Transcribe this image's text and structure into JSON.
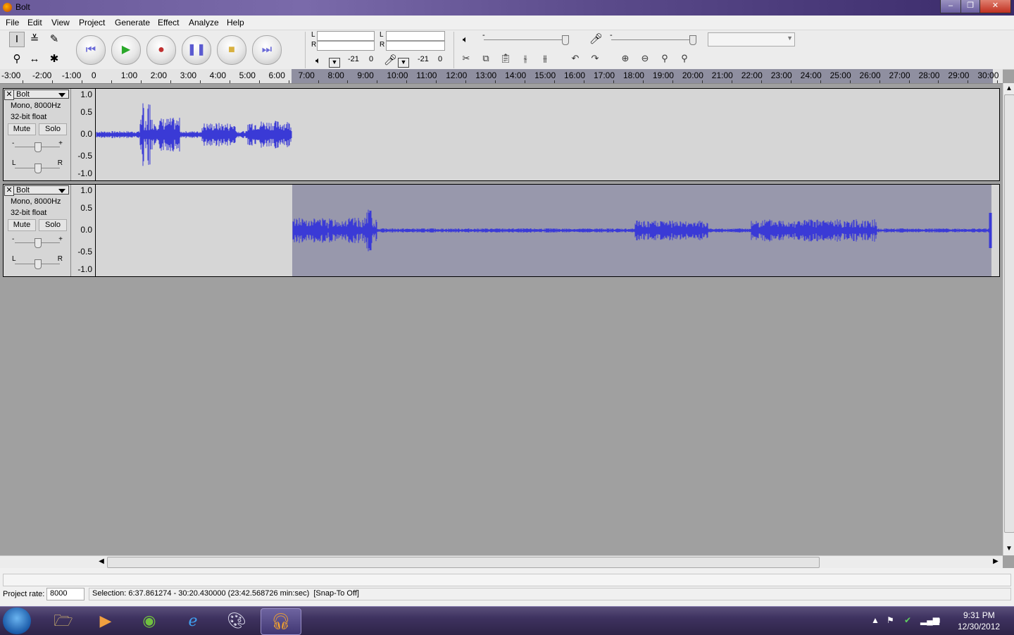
{
  "window": {
    "title": "Bolt"
  },
  "menu": [
    "File",
    "Edit",
    "View",
    "Project",
    "Generate",
    "Effect",
    "Analyze",
    "Help"
  ],
  "meters": {
    "playback": {
      "l": "L",
      "r": "R",
      "db": "-21",
      "zero": "0"
    },
    "record": {
      "l": "L",
      "r": "R",
      "db": "-21",
      "zero": "0"
    },
    "slider_minus": "-"
  },
  "ruler": {
    "labels": [
      "-3:00",
      "-2:00",
      "-1:00",
      "0",
      "1:00",
      "2:00",
      "3:00",
      "4:00",
      "5:00",
      "6:00",
      "7:00",
      "8:00",
      "9:00",
      "10:00",
      "11:00",
      "12:00",
      "13:00",
      "14:00",
      "15:00",
      "16:00",
      "17:00",
      "18:00",
      "19:00",
      "20:00",
      "21:00",
      "22:00",
      "23:00",
      "24:00",
      "25:00",
      "26:00",
      "27:00",
      "28:00",
      "29:00",
      "30:00"
    ]
  },
  "tracks": [
    {
      "name": "Bolt",
      "format": "Mono, 8000Hz",
      "bits": "32-bit float",
      "mute": "Mute",
      "solo": "Solo",
      "gain_minus": "-",
      "gain_plus": "+",
      "pan_l": "L",
      "pan_r": "R",
      "scale": [
        "1.0",
        "0.5",
        "0.0",
        "-0.5",
        "-1.0"
      ]
    },
    {
      "name": "Bolt",
      "format": "Mono, 8000Hz",
      "bits": "32-bit float",
      "mute": "Mute",
      "solo": "Solo",
      "gain_minus": "-",
      "gain_plus": "+",
      "pan_l": "L",
      "pan_r": "R",
      "scale": [
        "1.0",
        "0.5",
        "0.0",
        "-0.5",
        "-1.0"
      ]
    }
  ],
  "status": {
    "rate_label": "Project rate:",
    "rate_value": "8000",
    "selection": "Selection: 6:37.861274 - 30:20.430000 (23:42.568726 min:sec)  [Snap-To Off]"
  },
  "taskbar": {
    "time": "9:31 PM",
    "date": "12/30/2012",
    "apps": [
      "windows-explorer",
      "media-player",
      "windows-media-center",
      "internet-explorer",
      "paint",
      "audacity"
    ]
  },
  "colors": {
    "waveform": "#3a3ad6",
    "selection": "#9898ac",
    "ruler_selection": "#8f8fa0"
  }
}
